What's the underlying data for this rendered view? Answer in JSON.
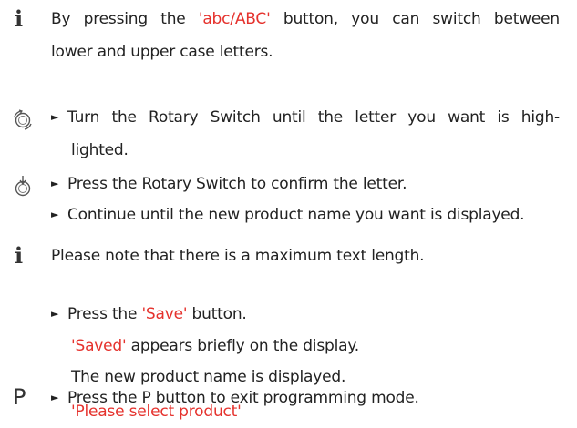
{
  "info1": {
    "icon": "info-icon",
    "line1_pre": "By pressing the ",
    "line1_highlight": "'abc/ABC'",
    "line1_post": " button, you can switch between",
    "line2": "lower and upper case letters."
  },
  "step_turn": {
    "icon": "rotary-turn-icon",
    "bullet": "►",
    "line1": "Turn the Rotary Switch until the letter you want is high-",
    "line2": "lighted."
  },
  "step_press": {
    "icon": "rotary-press-icon",
    "bullet": "►",
    "text": "Press the Rotary Switch to confirm the letter."
  },
  "step_continue": {
    "bullet": "►",
    "text": "Continue until the new product name you want is displayed."
  },
  "info2": {
    "icon": "info-icon",
    "text": "Please note that there is a maximum text length."
  },
  "step_save": {
    "bullet": "►",
    "pre": "Press the ",
    "highlight": "'Save'",
    "post": " button."
  },
  "result_saved": {
    "highlight": "'Saved'",
    "post": " appears briefly on the display."
  },
  "result_displayed": {
    "text": "The new product name is displayed."
  },
  "step_exit": {
    "icon_label": "P",
    "bullet": "►",
    "text": "Press the P button to exit programming mode."
  },
  "result_select": {
    "highlight": "'Please select product'"
  },
  "colors": {
    "highlight": "#e5322d",
    "text": "#222222"
  }
}
